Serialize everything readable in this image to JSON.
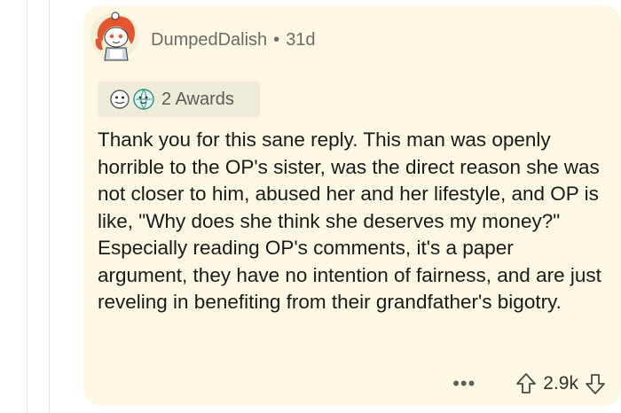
{
  "comment": {
    "author": "DumpedDalish",
    "separator": "•",
    "age": "31d",
    "awards_label": "2 Awards",
    "body": "Thank you for this sane reply. This man was openly horrible to the OP's sister, was the direct reason she was not closer to him, abused her and her lifestyle, and OP is like, \"Why does she think she deserves my money?\" Especially reading OP's comments, it's a paper argument, they have no intention of fairness, and are just reveling in benefiting from their grandfather's bigotry.",
    "more_label": "•••",
    "score": "2.9k"
  },
  "icons": {
    "avatar": "snoo-avatar-icon",
    "award1": "award-face-icon",
    "award2": "award-globe-icon",
    "more": "more-options-icon",
    "upvote": "upvote-arrow-icon",
    "downvote": "downvote-arrow-icon"
  },
  "colors": {
    "card_background": "#fcf8e3",
    "awards_background": "#efebd9",
    "text": "#1a1a1b",
    "meta_text": "#6d6a66",
    "avatar_hair": "#e2552f"
  }
}
